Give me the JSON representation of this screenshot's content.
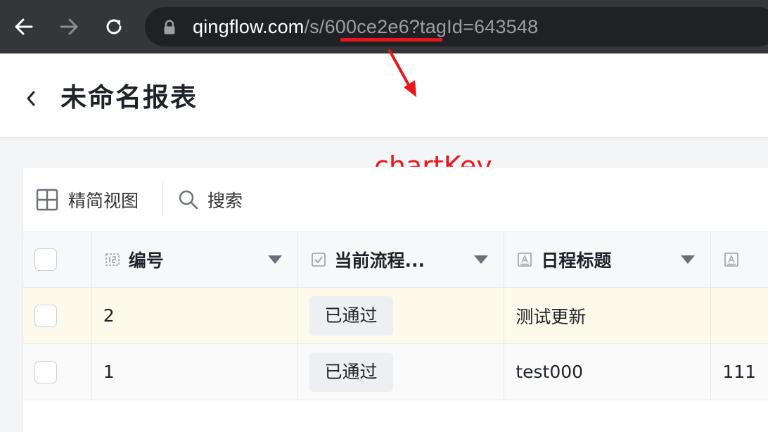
{
  "browser": {
    "url_host": "qingflow.com",
    "url_path": "/s/600ce2e6?tagId=643548"
  },
  "header": {
    "title": "未命名报表"
  },
  "annotation": {
    "label": "chartKey",
    "color": "#e8161b"
  },
  "toolbar": {
    "compact_view_label": "精简视图",
    "search_label": "搜索"
  },
  "table": {
    "columns": [
      {
        "label": "编号",
        "icon": "number-field-icon"
      },
      {
        "label": "当前流程...",
        "icon": "checkbox-field-icon"
      },
      {
        "label": "日程标题",
        "icon": "text-field-icon"
      }
    ],
    "rows": [
      {
        "no": "2",
        "status": "已通过",
        "title": "测试更新",
        "more": ""
      },
      {
        "no": "1",
        "status": "已通过",
        "title": "test000",
        "more": "111"
      }
    ]
  }
}
